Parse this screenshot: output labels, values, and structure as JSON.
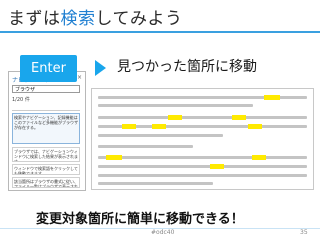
{
  "slide": {
    "title_pre": "まずは",
    "title_highlight": "検索",
    "title_post": "してみよう",
    "enter_key_label": "Enter",
    "caption": "見つかった箇所に移動",
    "subtitle": "変更対象箇所に簡単に移動できる！",
    "footer_tag": "#odc40",
    "page_number": "35"
  },
  "nav_pane": {
    "title": "ナビゲーション",
    "close": "×",
    "search_value": "ブラウザ",
    "result_count": "1/20 件",
    "results": [
      "検索やナビゲーション、記録機能はこのファイルなど多機能がブラウザが存在する。",
      "ブラウザでは、ナビゲーションウィンドウに検索した結果が表示されます。",
      "ウィンドウで検索語をクリックしても移動できます。",
      "該当箇所はブラウザの書式に従い、ファイル一覧はブラウザで表示されます。"
    ]
  },
  "colors": {
    "title_highlight": "#1f7fd1",
    "accent": "#19a6ec",
    "match_highlight": "#ffea00"
  }
}
